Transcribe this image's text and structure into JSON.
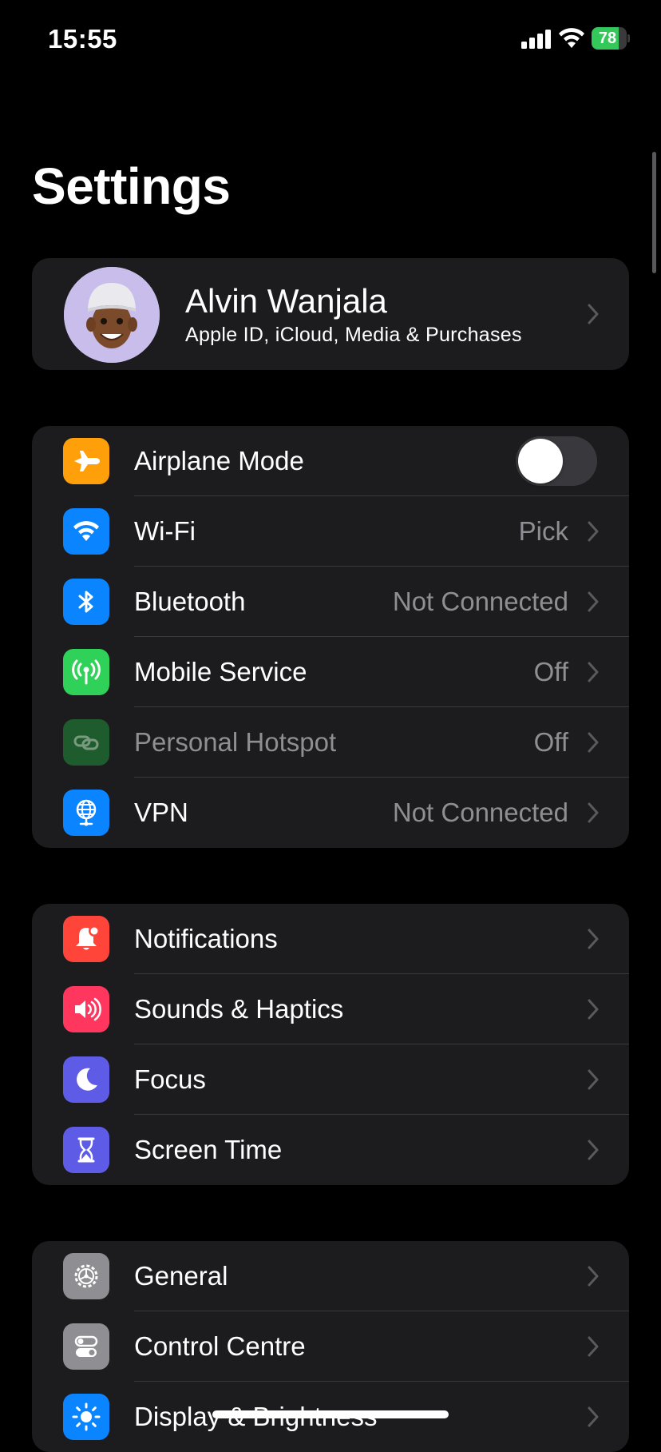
{
  "status_bar": {
    "time": "15:55",
    "battery_level": "78",
    "battery_fraction": 0.78,
    "charging": true
  },
  "page_title": "Settings",
  "profile": {
    "name": "Alvin Wanjala",
    "subtitle": "Apple ID, iCloud, Media & Purchases"
  },
  "connectivity": [
    {
      "label": "Airplane Mode",
      "value": "",
      "icon": "airplane-icon",
      "color": "#ff9f0a",
      "toggle_on": false
    },
    {
      "label": "Wi-Fi",
      "value": "Pick",
      "icon": "wifi-icon",
      "color": "#0a84ff"
    },
    {
      "label": "Bluetooth",
      "value": "Not Connected",
      "icon": "bluetooth-icon",
      "color": "#0a84ff"
    },
    {
      "label": "Mobile Service",
      "value": "Off",
      "icon": "antenna-icon",
      "color": "#30d158"
    },
    {
      "label": "Personal Hotspot",
      "value": "Off",
      "icon": "link-icon",
      "color": "#1e5c2e",
      "disabled": true
    },
    {
      "label": "VPN",
      "value": "Not Connected",
      "icon": "globe-icon",
      "color": "#0a84ff"
    }
  ],
  "attention": [
    {
      "label": "Notifications",
      "icon": "bell-icon",
      "color": "#ff453a"
    },
    {
      "label": "Sounds & Haptics",
      "icon": "speaker-icon",
      "color": "#ff375f"
    },
    {
      "label": "Focus",
      "icon": "moon-icon",
      "color": "#5e5ce6"
    },
    {
      "label": "Screen Time",
      "icon": "hourglass-icon",
      "color": "#5e5ce6"
    }
  ],
  "system": [
    {
      "label": "General",
      "icon": "gear-icon",
      "color": "#8e8e93"
    },
    {
      "label": "Control Centre",
      "icon": "switches-icon",
      "color": "#8e8e93"
    },
    {
      "label": "Display & Brightness",
      "icon": "sun-icon",
      "color": "#0a84ff"
    }
  ]
}
